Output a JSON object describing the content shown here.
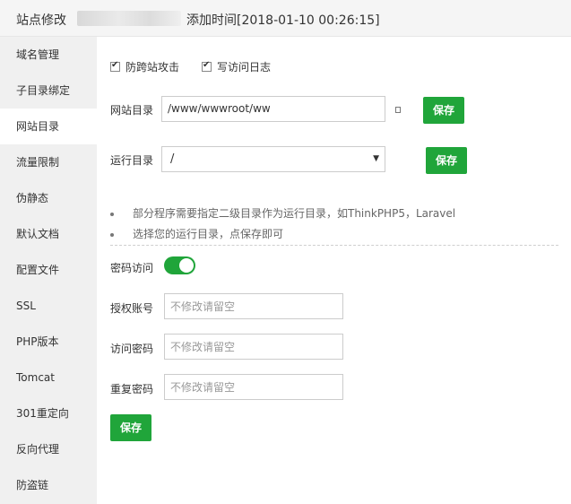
{
  "window": {
    "title_prefix": "站点修改",
    "title_suffix": "添加时间[2018-01-10 00:26:15]"
  },
  "sidebar": {
    "items": [
      {
        "label": "域名管理"
      },
      {
        "label": "子目录绑定"
      },
      {
        "label": "网站目录"
      },
      {
        "label": "流量限制"
      },
      {
        "label": "伪静态"
      },
      {
        "label": "默认文档"
      },
      {
        "label": "配置文件"
      },
      {
        "label": "SSL"
      },
      {
        "label": "PHP版本"
      },
      {
        "label": "Tomcat"
      },
      {
        "label": "301重定向"
      },
      {
        "label": "反向代理"
      },
      {
        "label": "防盗链"
      }
    ],
    "active_label": "网站目录"
  },
  "options": {
    "anti_xss_label": "防跨站攻击",
    "anti_xss_checked": true,
    "access_log_label": "写访问日志",
    "access_log_checked": true
  },
  "site_dir": {
    "label": "网站目录",
    "value": "/www/wwwroot/ww",
    "save_label": "保存"
  },
  "run_dir": {
    "label": "运行目录",
    "selected": "/",
    "save_label": "保存"
  },
  "tips": [
    "部分程序需要指定二级目录作为运行目录，如ThinkPHP5，Laravel",
    "选择您的运行目录，点保存即可"
  ],
  "password_access": {
    "label": "密码访问",
    "enabled": true,
    "account_label": "授权账号",
    "account_placeholder": "不修改请留空",
    "password_label": "访问密码",
    "password_placeholder": "不修改请留空",
    "repeat_label": "重复密码",
    "repeat_placeholder": "不修改请留空",
    "save_label": "保存"
  },
  "colors": {
    "accent": "#20a53a",
    "sidebar_bg": "#f0f0f0",
    "titlebar_bg": "#f5f5f5"
  }
}
